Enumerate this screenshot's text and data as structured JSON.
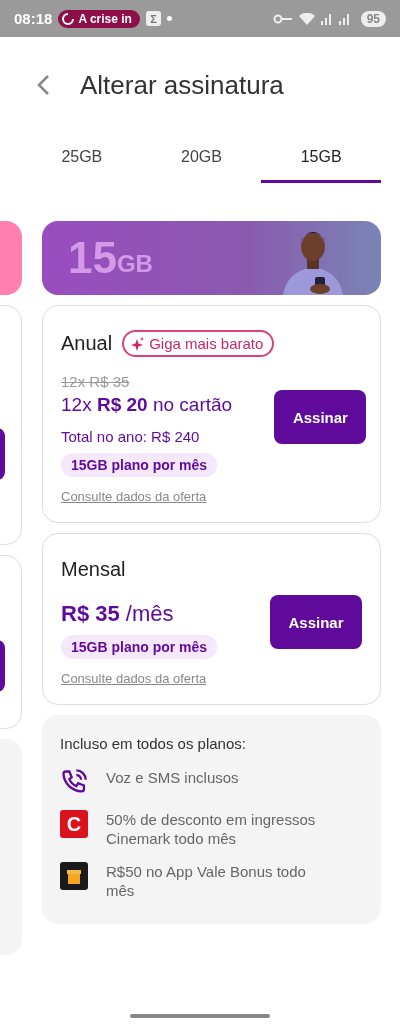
{
  "status_bar": {
    "time": "08:18",
    "media_chip": "A crise in",
    "app_badge": "Σ",
    "battery": "95"
  },
  "header": {
    "title": "Alterar assinatura"
  },
  "tabs": [
    {
      "label": "25GB",
      "selected": false
    },
    {
      "label": "20GB",
      "selected": false
    },
    {
      "label": "15GB",
      "selected": true
    }
  ],
  "banner": {
    "amount": "15",
    "unit": "GB",
    "kind": "picture"
  },
  "plans": [
    {
      "kind": "annual",
      "name": "Anual",
      "badge": "Giga mais barato",
      "old_price": "12x R$ 35",
      "price": "12x **R$ 20** no cartão",
      "total": "Total no ano: R$ 240",
      "data_tag": "15GB plano por mês",
      "link": "Consulte dados da oferta",
      "button": "Assinar"
    },
    {
      "kind": "monthly",
      "name": "Mensal",
      "price": "**R$ 35** /mês",
      "data_tag": "15GB plano por mês",
      "link": "Consulte dados da oferta",
      "button": "Assinar"
    }
  ],
  "inclusions": {
    "title": "Incluso em todos os planos:",
    "items": [
      {
        "kind": "phone",
        "text": "Voz e SMS inclusos"
      },
      {
        "kind": "cinema",
        "logo": "C",
        "text": "50% de desconto em ingressos Cinemark todo mês"
      },
      {
        "kind": "gift",
        "text": "R$50 no App Vale Bonus todo mês"
      }
    ]
  }
}
